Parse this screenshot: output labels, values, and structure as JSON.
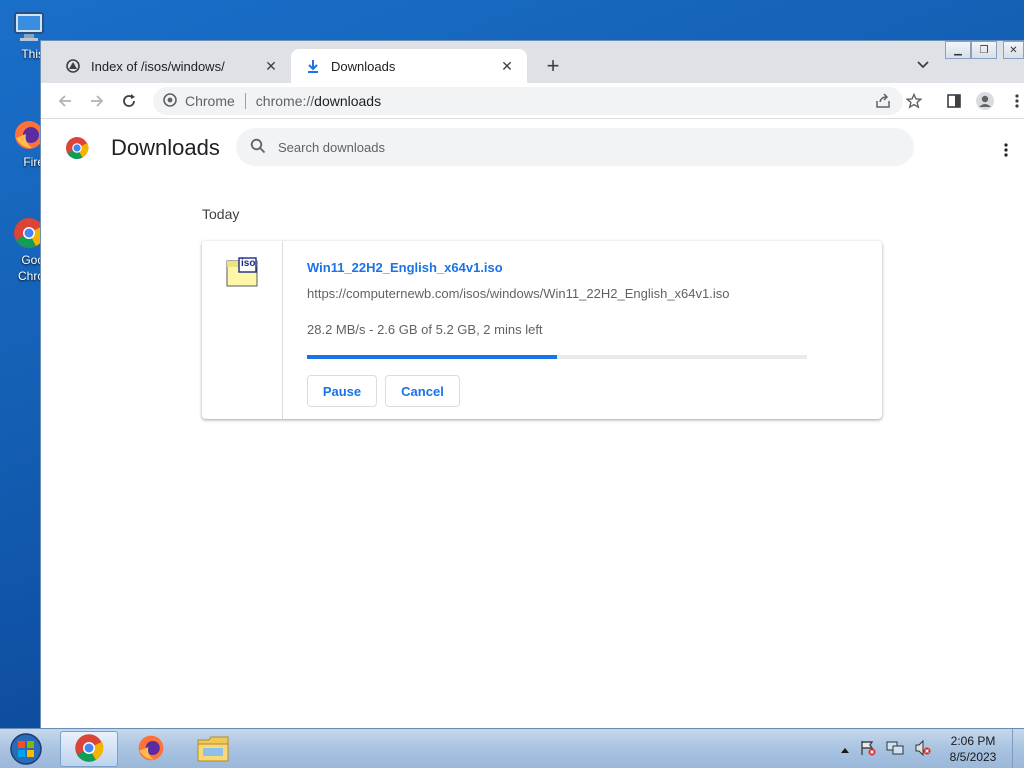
{
  "desktop": {
    "icons": [
      {
        "label": "This",
        "icon": "computer-icon"
      },
      {
        "label": "Fire",
        "icon": "firefox-icon"
      },
      {
        "label": "Goo",
        "label2": "Chro",
        "icon": "chrome-icon"
      }
    ]
  },
  "browser": {
    "tabs": [
      {
        "title": "Index of /isos/windows/",
        "icon": "page-icon",
        "active": false
      },
      {
        "title": "Downloads",
        "icon": "download-icon",
        "active": true
      }
    ],
    "omnibox": {
      "scheme_label": "Chrome",
      "url_prefix": "chrome://",
      "url_host": "downloads"
    }
  },
  "downloads_page": {
    "title": "Downloads",
    "search_placeholder": "Search downloads",
    "section_date": "Today",
    "items": [
      {
        "file_name": "Win11_22H2_English_x64v1.iso",
        "source_url": "https://computernewb.com/isos/windows/Win11_22H2_English_x64v1.iso",
        "status": "28.2 MB/s - 2.6 GB of 5.2 GB, 2 mins left",
        "progress": 0.5,
        "file_icon_text": "iso",
        "buttons": {
          "pause": "Pause",
          "cancel": "Cancel"
        }
      }
    ]
  },
  "taskbar": {
    "clock_time": "2:06 PM",
    "clock_date": "8/5/2023",
    "apps": [
      "chrome-icon",
      "firefox-icon",
      "explorer-icon"
    ]
  },
  "colors": {
    "accent": "#1a73e8",
    "tabstrip": "#dee1e6",
    "omnibox_bg": "#f1f3f4",
    "desktop": "#1460b5"
  }
}
